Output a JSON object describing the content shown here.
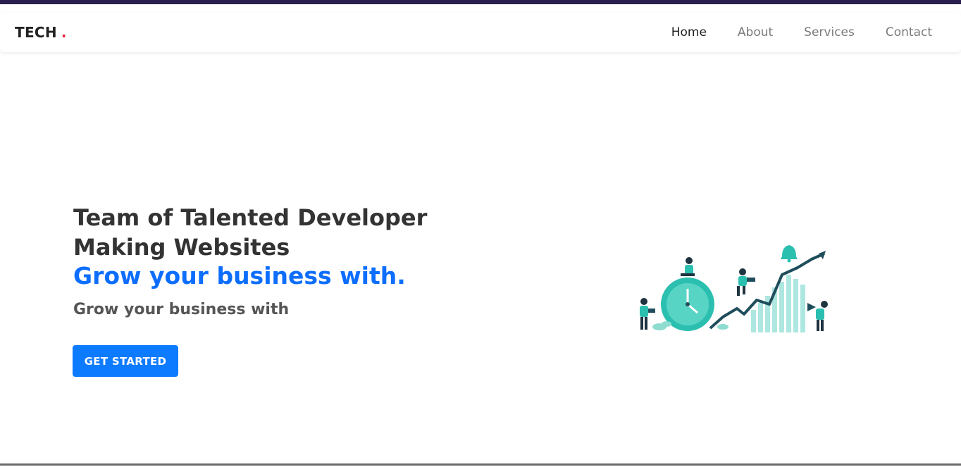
{
  "navbar": {
    "brand": "TECH",
    "brand_dot": ".",
    "links": [
      {
        "label": "Home",
        "active": true
      },
      {
        "label": "About",
        "active": false
      },
      {
        "label": "Services",
        "active": false
      },
      {
        "label": "Contact",
        "active": false
      }
    ]
  },
  "hero": {
    "title_line1": "Team of Talented Developer",
    "title_line2": "Making Websites",
    "accent": "Grow your business with.",
    "subtitle": "Grow your business with",
    "cta_label": "GET STARTED"
  },
  "colors": {
    "accent": "#0d6efd",
    "brand_dot": "#e0263a",
    "illustration_teal": "#2bbfb0",
    "illustration_dark": "#1f4d5c"
  },
  "icons": {
    "illustration": "growth-chart-illustration"
  }
}
